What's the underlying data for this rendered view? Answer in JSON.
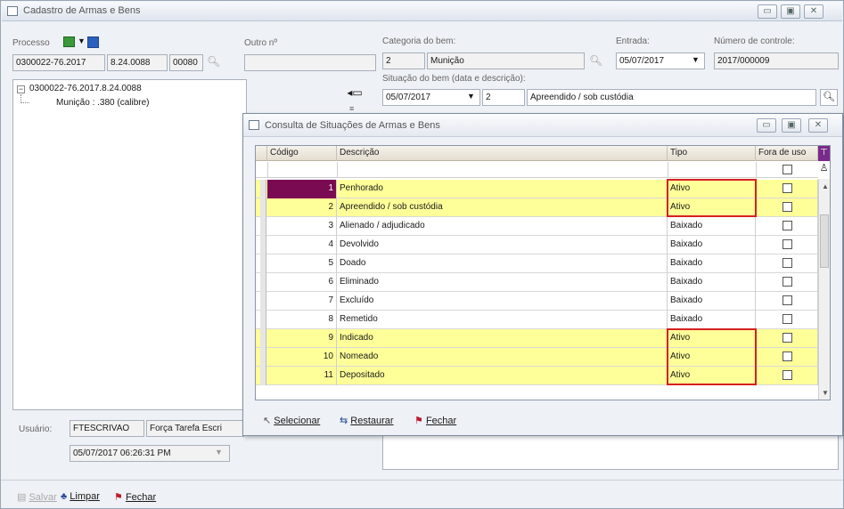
{
  "main": {
    "title": "Cadastro de Armas e Bens",
    "processo_label": "Processo",
    "processo_number": "0300022-76.2017",
    "processo_part2": "8.24.0088",
    "processo_part3": "00080",
    "outro_label": "Outro nº",
    "outro_value": "",
    "categoria_label": "Categoria do bem:",
    "categoria_code": "2",
    "categoria_name": "Munição",
    "entrada_label": "Entrada:",
    "entrada_value": "05/07/2017",
    "controle_label": "Número de controle:",
    "controle_value": "2017/000009",
    "situacao_label": "Situação do bem (data e descrição):",
    "situacao_date": "05/07/2017",
    "situacao_code": "2",
    "situacao_desc": "Apreendido / sob custódia",
    "tree_root": "0300022-76.2017.8.24.0088",
    "tree_child": "Munição : .380 (calibre)",
    "usuario_label": "Usuário:",
    "usuario_login": "FTESCRIVAO",
    "usuario_name": "Força Tarefa Escri",
    "usuario_date": "05/07/2017 06:26:31 PM",
    "btn_salvar": "Salvar",
    "btn_limpar": "Limpar",
    "btn_fechar": "Fechar"
  },
  "dialog": {
    "title": "Consulta de Situações de Armas e Bens",
    "columns": [
      "Código",
      "Descrição",
      "Tipo",
      "Fora de uso"
    ],
    "rows": [
      {
        "code": "1",
        "desc": "Penhorado",
        "tipo": "Ativo",
        "highlight": true
      },
      {
        "code": "2",
        "desc": "Apreendido / sob custódia",
        "tipo": "Ativo",
        "highlight": true
      },
      {
        "code": "3",
        "desc": "Alienado / adjudicado",
        "tipo": "Baixado",
        "highlight": false
      },
      {
        "code": "4",
        "desc": "Devolvido",
        "tipo": "Baixado",
        "highlight": false
      },
      {
        "code": "5",
        "desc": "Doado",
        "tipo": "Baixado",
        "highlight": false
      },
      {
        "code": "6",
        "desc": "Eliminado",
        "tipo": "Baixado",
        "highlight": false
      },
      {
        "code": "7",
        "desc": "Excluído",
        "tipo": "Baixado",
        "highlight": false
      },
      {
        "code": "8",
        "desc": "Remetido",
        "tipo": "Baixado",
        "highlight": false
      },
      {
        "code": "9",
        "desc": "Indicado",
        "tipo": "Ativo",
        "highlight": true
      },
      {
        "code": "10",
        "desc": "Nomeado",
        "tipo": "Ativo",
        "highlight": true
      },
      {
        "code": "11",
        "desc": "Depositado",
        "tipo": "Ativo",
        "highlight": true
      }
    ],
    "btn_selecionar": "Selecionar",
    "btn_restaurar": "Restaurar",
    "btn_fechar": "Fechar"
  },
  "colors": {
    "highlight": "#ffff99",
    "red_box": "#d62020",
    "selected_cell": "#7a0a52"
  }
}
